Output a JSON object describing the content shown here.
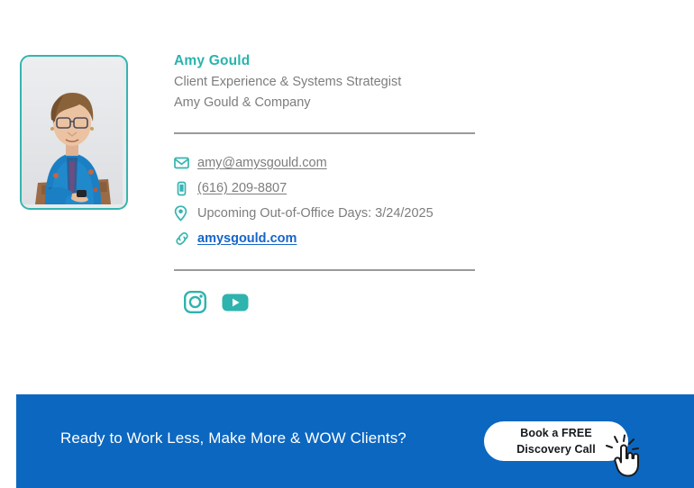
{
  "signature": {
    "photo": {
      "alt_name": "amy-gould-headshot",
      "border_color": "#35b5b0"
    },
    "name": "Amy Gould",
    "title": "Client Experience & Systems Strategist",
    "company": "Amy Gould & Company",
    "accent_color": "#29b3ad",
    "text_color": "#7d7d7d",
    "link_color": "#1565c8",
    "contacts": [
      {
        "icon": "envelope-icon",
        "text": "amy@amysgould.com",
        "style": "link"
      },
      {
        "icon": "mobile-phone-icon",
        "text": "(616) 209-8807",
        "style": "link"
      },
      {
        "icon": "location-pin-icon",
        "text": "Upcoming Out-of-Office Days: 3/24/2025",
        "style": "plain"
      },
      {
        "icon": "chain-link-icon",
        "text": "amysgould.com",
        "style": "weblink"
      }
    ],
    "social": [
      {
        "icon": "instagram-icon",
        "label": "Instagram"
      },
      {
        "icon": "youtube-icon",
        "label": "YouTube"
      }
    ]
  },
  "cta": {
    "background_color": "#0c67c0",
    "headline": "Ready to Work Less, Make More & WOW Clients?",
    "button": {
      "line1": "Book a FREE",
      "line2": "Discovery Call"
    },
    "cursor_icon": "pointing-hand-click-icon"
  }
}
